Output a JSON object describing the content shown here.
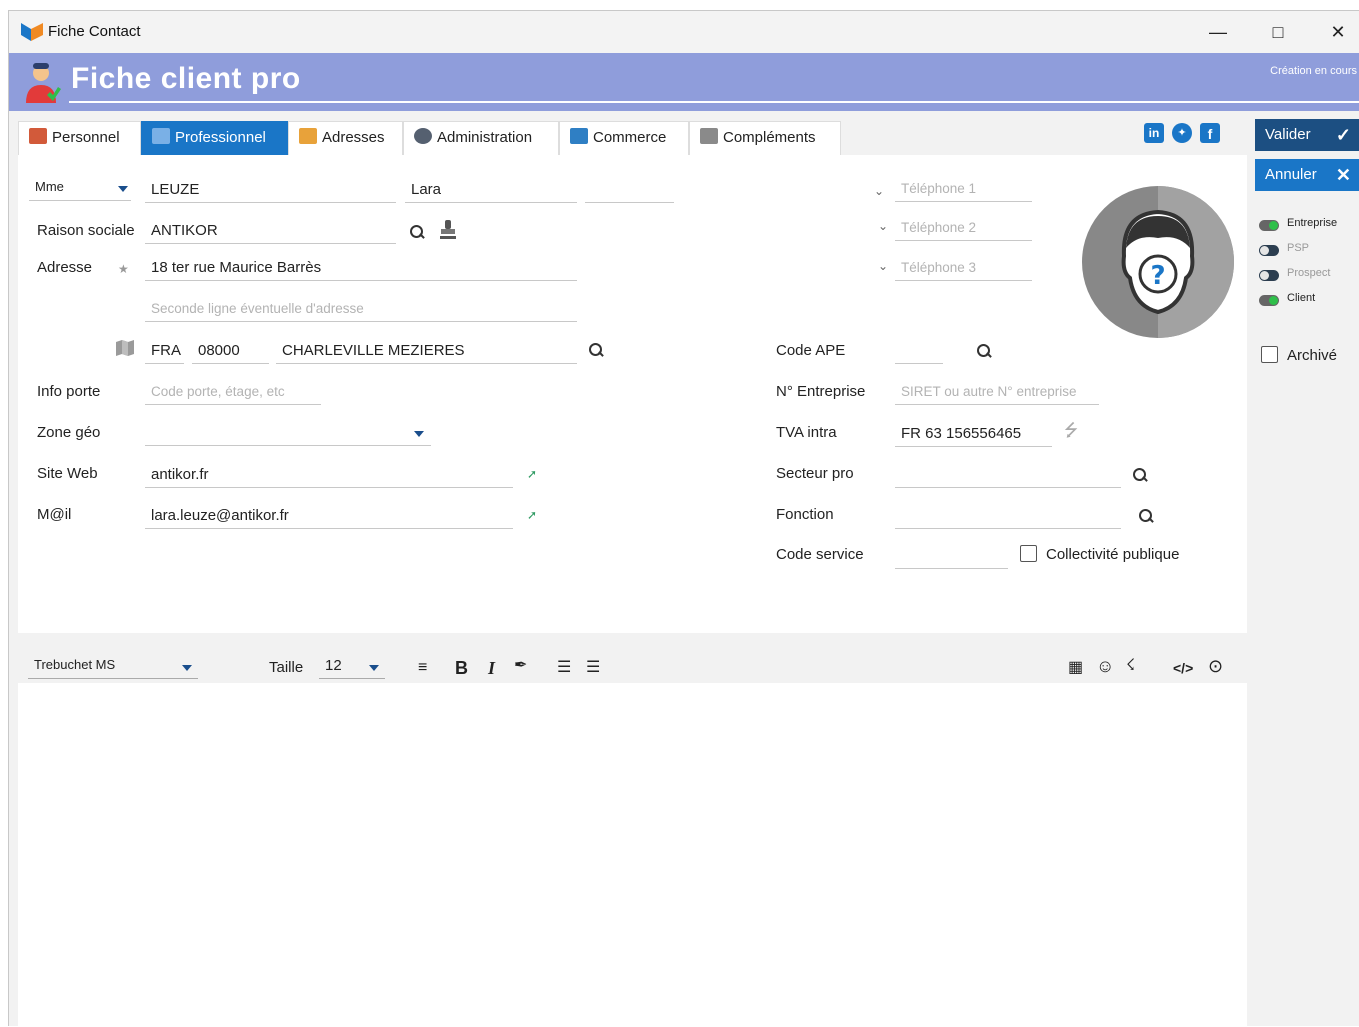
{
  "window": {
    "title": "Fiche Contact"
  },
  "header": {
    "title": "Fiche client pro",
    "status": "Création en cours"
  },
  "tabs": [
    {
      "label": "Personnel"
    },
    {
      "label": "Professionnel"
    },
    {
      "label": "Adresses"
    },
    {
      "label": "Administration"
    },
    {
      "label": "Commerce"
    },
    {
      "label": "Compléments"
    }
  ],
  "identity": {
    "civility": "Mme",
    "last_name": "LEUZE",
    "first_name": "Lara",
    "extra": ""
  },
  "labels": {
    "raison_sociale": "Raison sociale",
    "adresse": "Adresse",
    "info_porte": "Info porte",
    "zone_geo": "Zone géo",
    "site_web": "Site Web",
    "email": "M@il",
    "code_ape": "Code APE",
    "n_entreprise": "N° Entreprise",
    "tva_intra": "TVA intra",
    "secteur_pro": "Secteur pro",
    "fonction": "Fonction",
    "code_service": "Code service",
    "collectivite": "Collectivité publique"
  },
  "values": {
    "raison_sociale": "ANTIKOR",
    "adresse_1": "18 ter rue Maurice Barrès",
    "pays": "FRA",
    "code_postal": "08000",
    "ville": "CHARLEVILLE MEZIERES",
    "zone_geo": "",
    "site_web": "antikor.fr",
    "email": "lara.leuze@antikor.fr",
    "code_ape": "",
    "tva_intra": "FR 63 156556465",
    "secteur_pro": "",
    "fonction": "",
    "code_service": ""
  },
  "placeholders": {
    "adresse_2": "Seconde ligne éventuelle d'adresse",
    "info_porte": "Code porte, étage, etc",
    "telephone_1": "Téléphone 1",
    "telephone_2": "Téléphone 2",
    "telephone_3": "Téléphone 3",
    "n_entreprise": "SIRET ou autre N° entreprise"
  },
  "social": [
    {
      "icon": "linkedin-icon"
    },
    {
      "icon": "twitter-icon"
    },
    {
      "icon": "facebook-icon"
    }
  ],
  "actions": {
    "valider": "Valider",
    "annuler": "Annuler"
  },
  "flags": [
    {
      "label": "Entreprise",
      "on": true
    },
    {
      "label": "PSP",
      "on": false
    },
    {
      "label": "Prospect",
      "on": false
    },
    {
      "label": "Client",
      "on": true
    }
  ],
  "archive": {
    "label": "Archivé",
    "checked": false
  },
  "editor": {
    "font": "Trebuchet MS",
    "size_label": "Taille",
    "size": "12"
  },
  "colors": {
    "header": "#8f9ddb",
    "accent": "#1a76c7",
    "valider": "#1c4f82",
    "toggle_on": "#2fbf4a"
  }
}
